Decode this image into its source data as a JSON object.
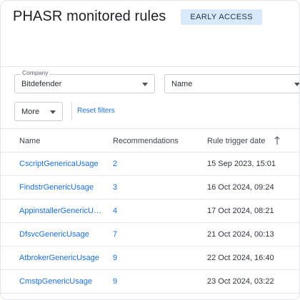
{
  "header": {
    "title": "PHASR monitored rules",
    "badge": "EARLY ACCESS"
  },
  "filters": {
    "company": {
      "label": "Company",
      "value": "Bitdefender"
    },
    "name": {
      "value": "Name"
    },
    "more": {
      "value": "More"
    },
    "reset_label": "Reset filters"
  },
  "table": {
    "columns": [
      "Name",
      "Recommendations",
      "Rule trigger date"
    ],
    "sort_icon": "arrow-up-icon",
    "rows": [
      {
        "name": "CscriptGenericaUsage",
        "recommendations": "2",
        "date": "15 Sep 2023, 15:01"
      },
      {
        "name": "FindstrGenericUsage",
        "recommendations": "3",
        "date": "16 Oct 2024, 09:24"
      },
      {
        "name": "AppinstallerGenericUs...",
        "recommendations": "4",
        "date": "17 Oct 2024, 08:21"
      },
      {
        "name": "DfsvcGenericUsage",
        "recommendations": "7",
        "date": "21 Oct 2024, 00:13"
      },
      {
        "name": "AtbrokerGenericUsage",
        "recommendations": "9",
        "date": "22 Oct 2024, 16:40"
      },
      {
        "name": "CmstpGenericUsage",
        "recommendations": "9",
        "date": "23 Oct 2024, 03:22"
      }
    ]
  },
  "colors": {
    "link": "#1a6fd6",
    "badge_bg": "#d9e8fb",
    "border": "#e6e8ec"
  }
}
